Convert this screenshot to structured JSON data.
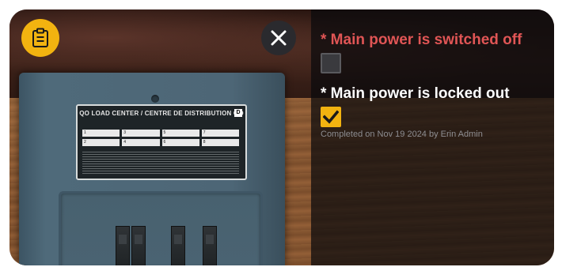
{
  "scene": {
    "panel_label_title": "QO LOAD CENTER / CENTRE DE DISTRIBUTION QO",
    "panel_logo": "D",
    "panel_slots": [
      "1",
      "3",
      "5",
      "7",
      "2",
      "4",
      "6",
      "8"
    ]
  },
  "toolbar": {
    "checklist_icon": "clipboard-icon",
    "close_icon": "close-icon"
  },
  "checklist": {
    "items": [
      {
        "label": "* Main power is switched off",
        "checked": false,
        "color": "#e05555"
      },
      {
        "label": "* Main power is locked out",
        "checked": true,
        "color": "#ffffff"
      }
    ],
    "completed_text": "Completed on Nov 19 2024 by Erin Admin"
  },
  "colors": {
    "accent": "#f2b310",
    "required_item": "#e05555",
    "overlay": "#0a0a0c"
  }
}
